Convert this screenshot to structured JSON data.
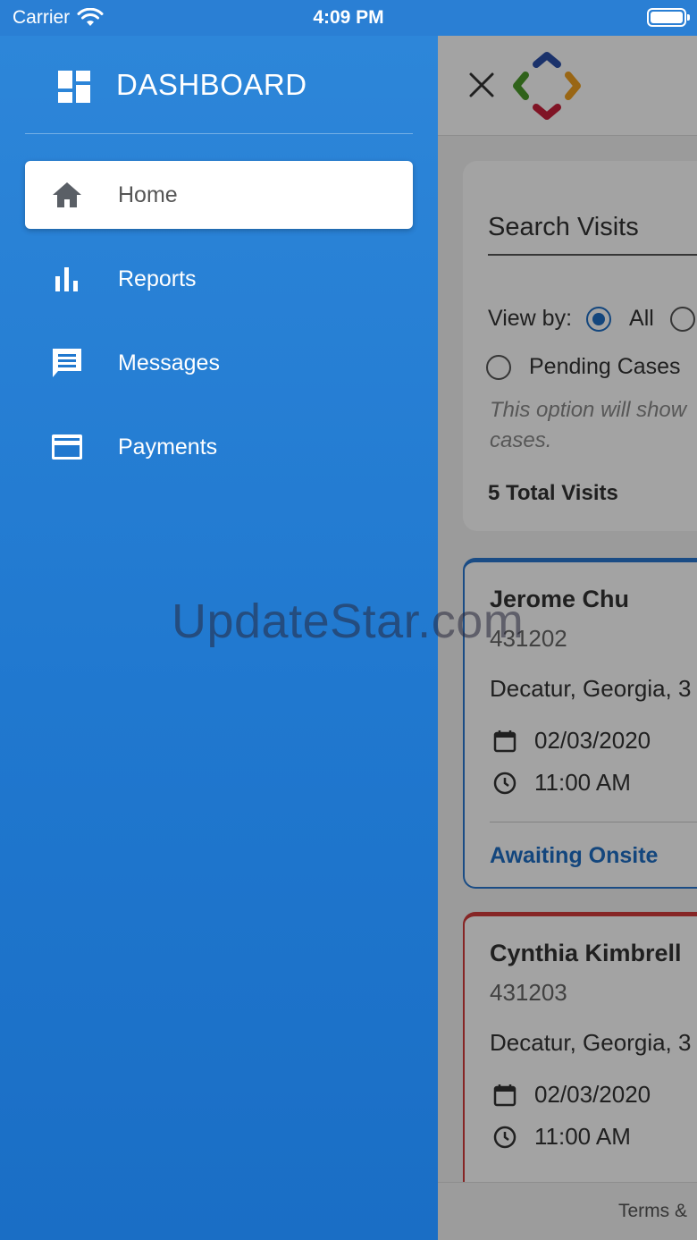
{
  "status_bar": {
    "carrier": "Carrier",
    "time": "4:09 PM"
  },
  "drawer": {
    "title": "DASHBOARD",
    "items": [
      {
        "label": "Home",
        "icon": "home-icon",
        "active": true
      },
      {
        "label": "Reports",
        "icon": "bar-chart-icon",
        "active": false
      },
      {
        "label": "Messages",
        "icon": "message-icon",
        "active": false
      },
      {
        "label": "Payments",
        "icon": "credit-card-icon",
        "active": false
      }
    ]
  },
  "search": {
    "label": "Search Visits",
    "view_by_label": "View by:",
    "option_all": "All",
    "option_pending": "Pending Cases",
    "hint": "This option will show cases.",
    "hint_line1": "This option will show",
    "hint_line2": "cases.",
    "total": "5 Total Visits"
  },
  "visits": [
    {
      "name": "Jerome Chu",
      "number": "431202",
      "location": "Decatur, Georgia, 3",
      "date": "02/03/2020",
      "time": "11:00 AM",
      "status": "Awaiting Onsite",
      "accent": "#2a78d0"
    },
    {
      "name": "Cynthia Kimbrell",
      "number": "431203",
      "location": "Decatur, Georgia, 3",
      "date": "02/03/2020",
      "time": "11:00 AM",
      "accent": "#d23a3a"
    }
  ],
  "footer": {
    "text": "Terms &"
  },
  "watermark": "UpdateStar.com",
  "colors": {
    "drawer": "#2078cf",
    "accent": "#1e6ec4",
    "alert": "#d23a3a"
  }
}
